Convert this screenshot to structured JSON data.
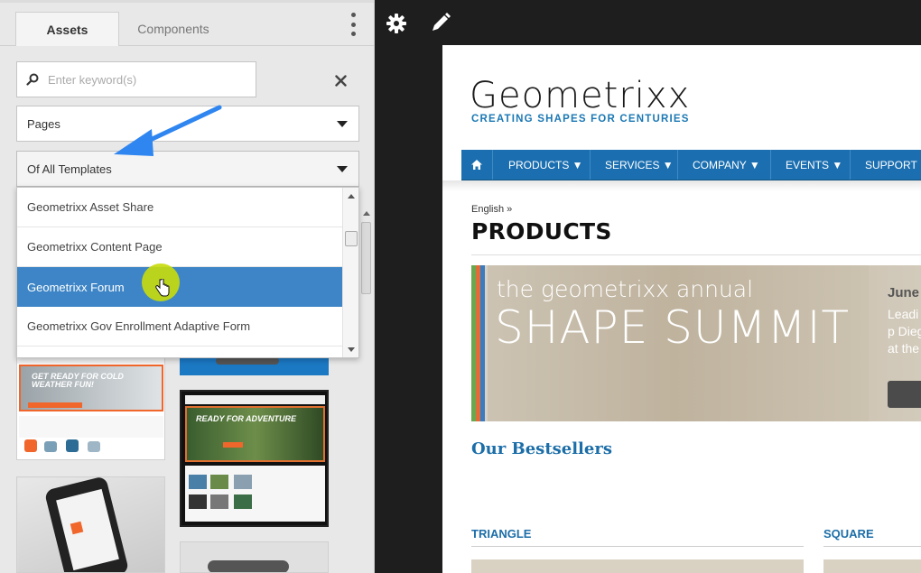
{
  "rail": {
    "tabs": [
      {
        "label": "Assets"
      },
      {
        "label": "Components"
      }
    ],
    "search": {
      "placeholder": "Enter keyword(s)"
    },
    "type_select": {
      "value": "Pages"
    },
    "template_select": {
      "value": "Of All Templates"
    },
    "dropdown": {
      "options": [
        "Geometrixx Asset Share",
        "Geometrixx Content Page",
        "Geometrixx Forum",
        "Geometrixx Gov Enrollment Adaptive Form"
      ],
      "highlighted": "Geometrixx Forum"
    },
    "thumbnails": [
      {
        "text": "GET READY FOR COLD WEATHER FUN!"
      },
      {
        "text": ""
      },
      {
        "text": "READY FOR ADVENTURE"
      },
      {
        "text": ""
      },
      {
        "text": ""
      }
    ]
  },
  "toolbar": {
    "icons": [
      "gear-icon",
      "pencil-icon"
    ]
  },
  "page": {
    "logo": {
      "title": "Geometrixx",
      "tagline": "CREATING SHAPES FOR CENTURIES"
    },
    "nav": [
      "PRODUCTS ▼",
      "SERVICES ▼",
      "COMPANY ▼",
      "EVENTS ▼",
      "SUPPORT ▼"
    ],
    "breadcrumb": "English »",
    "title": "PRODUCTS",
    "banner": {
      "line1": "the geometrixx annual",
      "line2": "SHAPE SUMMIT",
      "date": "June",
      "desc": "Leadi will p Diego at the"
    },
    "bestsellers": "Our Bestsellers",
    "columns": [
      "TRIANGLE",
      "SQUARE"
    ]
  },
  "colors": {
    "accent": "#3d85c6",
    "nav": "#1b6fb1",
    "link": "#1c6ea8",
    "toolbar": "#1e1e1e",
    "arrow": "#2f86f0"
  }
}
